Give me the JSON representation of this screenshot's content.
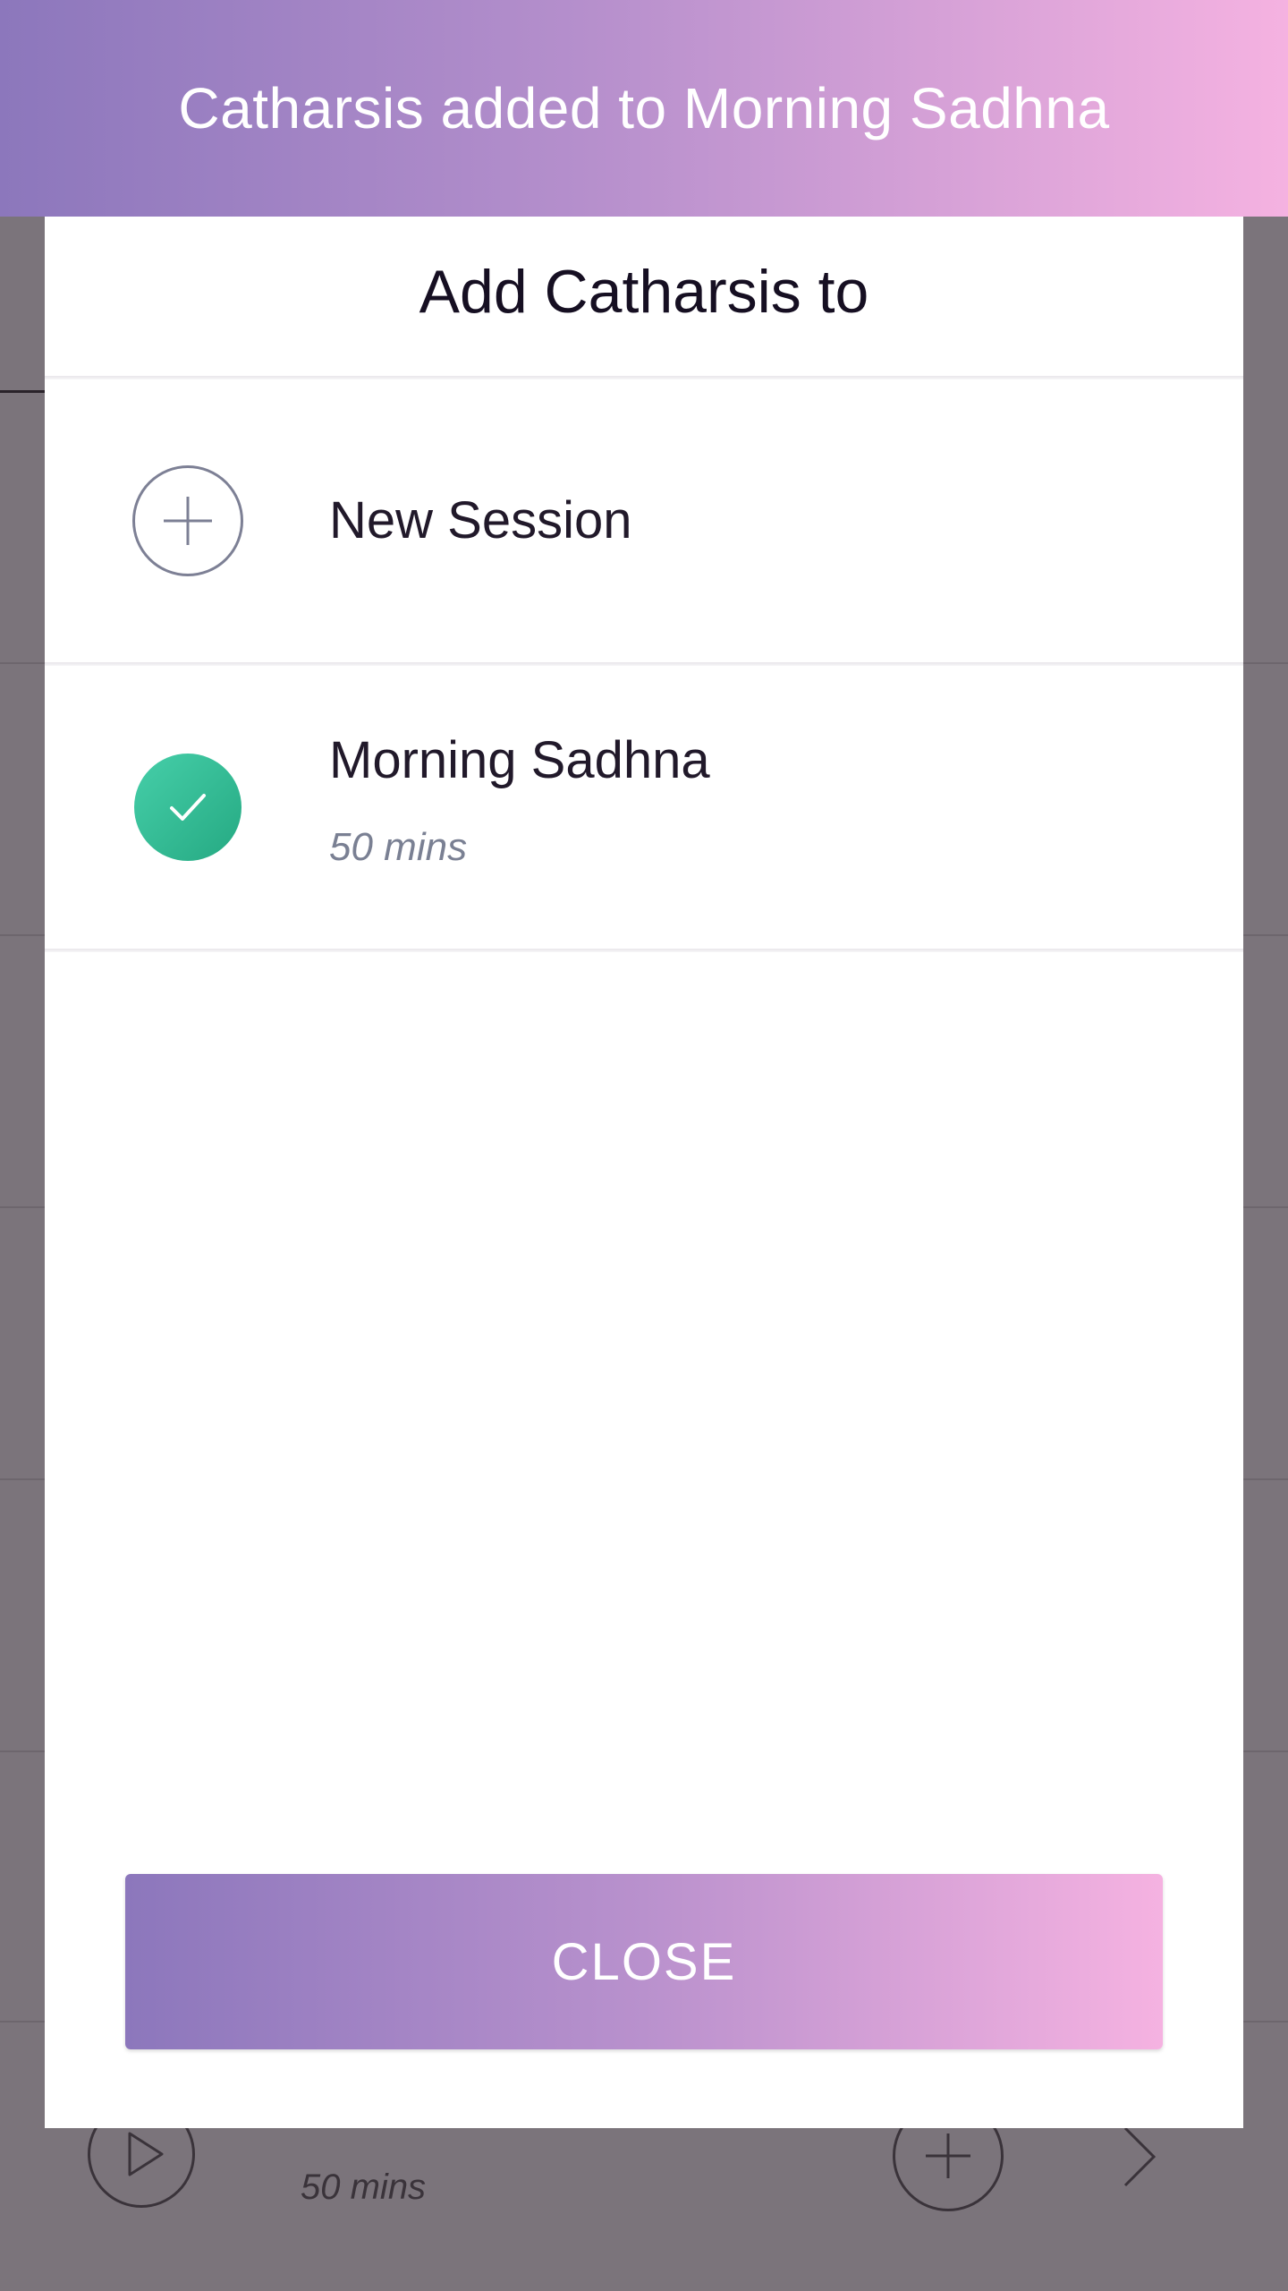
{
  "toast": {
    "message": "Catharsis added to Morning Sadhna"
  },
  "modal": {
    "title": "Add Catharsis to",
    "options": [
      {
        "label": "New Session",
        "icon": "plus-circle-icon"
      },
      {
        "label": "Morning Sadhna",
        "duration": "50 mins",
        "icon": "check-circle-icon",
        "selected": true
      }
    ],
    "close_label": "CLOSE"
  },
  "background": {
    "item_duration": "50 mins"
  },
  "colors": {
    "gradient_start": "#8c77bc",
    "gradient_end": "#f5b2e1",
    "check_green": "#2bb48b",
    "overlay": "#7b747b"
  }
}
